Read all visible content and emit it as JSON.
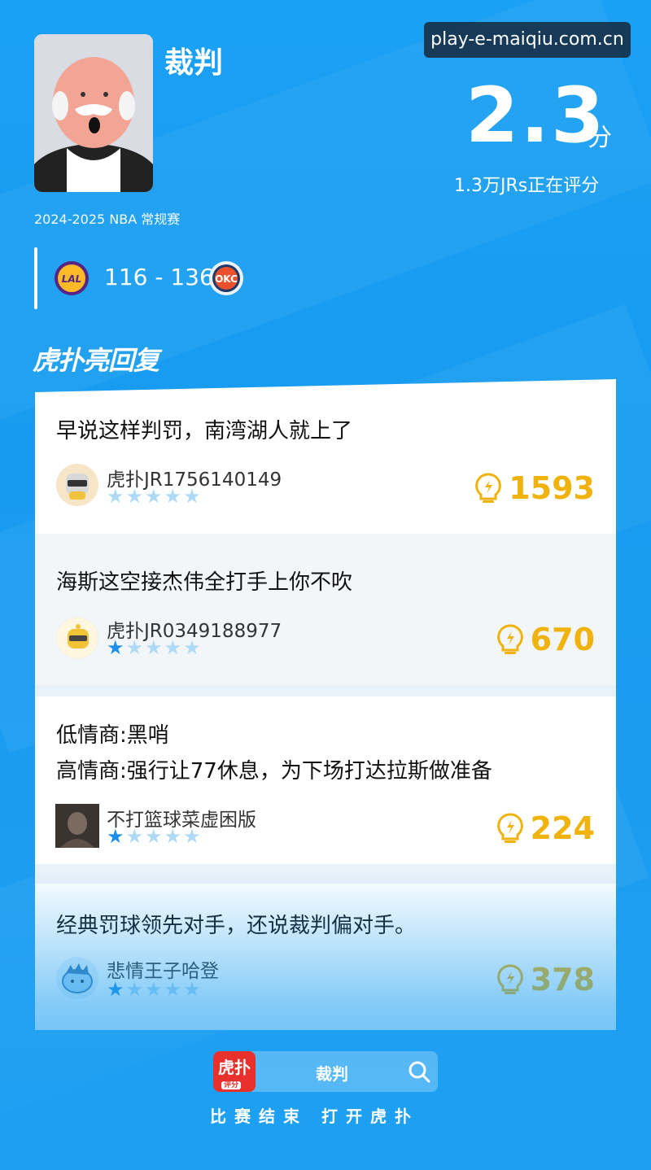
{
  "watermark": "play-e-maiqiu.com.cn",
  "header": {
    "title": "裁判",
    "season": "2024-2025 NBA 常规赛",
    "score": "116 - 136",
    "team_home_logo": "LAL",
    "team_away_logo": "OKC"
  },
  "rating": {
    "score": "2.3",
    "unit": "分",
    "count_text": "1.3万JRs正在评分"
  },
  "section": {
    "title": "虎扑亮回复"
  },
  "comments": [
    {
      "text": "早说这样判罚，南湾湖人就上了",
      "user": "虎扑JR1756140149",
      "stars": 0,
      "likes": "1593"
    },
    {
      "text": "海斯这空接杰伟全打手上你不吹",
      "user": "虎扑JR0349188977",
      "stars": 1,
      "likes": "670"
    },
    {
      "text": "低情商:黑哨",
      "text2": "高情商:强行让77休息，为下场打达拉斯做准备",
      "user": "不打篮球菜虚困版",
      "stars": 1,
      "likes": "224"
    },
    {
      "text": "经典罚球领先对手，还说裁判偏对手。",
      "user": "悲情王子哈登",
      "stars": 1,
      "likes": "378"
    }
  ],
  "footer": {
    "app_icon_text": "虎扑",
    "app_icon_sub": "评分",
    "search_text": "裁判",
    "caption": "比赛结束 打开虎扑"
  },
  "colors": {
    "background": "#1a9cf0",
    "likes": "#f0b20c",
    "star_on": "#1e8fe8",
    "star_off": "#aedaf6"
  }
}
